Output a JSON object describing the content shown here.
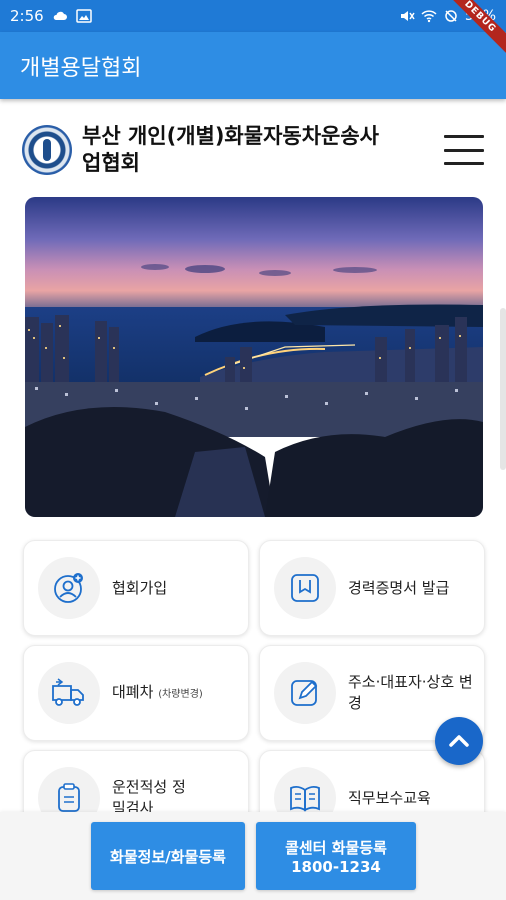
{
  "status_bar": {
    "time": "2:56",
    "battery": "57%"
  },
  "app_bar": {
    "title": "개별용달협회"
  },
  "debug_banner": "DEBUG",
  "header": {
    "org_name": "부산 개인(개별)화물자동차운송사업협회"
  },
  "menu_cards": [
    {
      "label": "협회가입",
      "icon": "user-add-icon"
    },
    {
      "label": "경력증명서 발급",
      "icon": "bookmark-icon"
    },
    {
      "label": "대폐차",
      "sub": "(차량변경)",
      "icon": "truck-icon"
    },
    {
      "label": "주소·대표자·상호 변경",
      "icon": "edit-icon"
    },
    {
      "label": "운전적성 정밀검사",
      "icon": "clipboard-icon"
    },
    {
      "label": "직무보수교육",
      "icon": "book-icon"
    }
  ],
  "fab": {
    "icon": "chevron-up-icon"
  },
  "bottom_buttons": {
    "cargo_info": "화물정보/화물등록",
    "callcenter_title": "콜센터 화물등록",
    "callcenter_phone": "1800-1234"
  },
  "colors": {
    "primary": "#2e8de4",
    "status": "#1f7ad6",
    "fab": "#1967c9"
  }
}
